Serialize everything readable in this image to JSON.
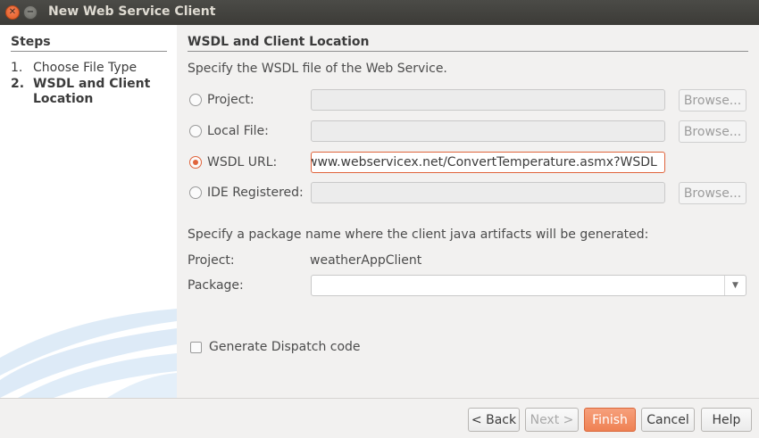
{
  "window": {
    "title": "New Web Service Client"
  },
  "steps": {
    "title": "Steps",
    "items": [
      {
        "num": "1.",
        "label": "Choose File Type"
      },
      {
        "num": "2.",
        "label": "WSDL and Client Location"
      }
    ]
  },
  "section": {
    "title": "WSDL and Client Location",
    "wsdl_prompt": "Specify the WSDL file of the Web Service.",
    "package_prompt": "Specify a package name where the client java artifacts will be generated:"
  },
  "sources": [
    {
      "label": "Project:",
      "value": "",
      "selected": false,
      "browse": "Browse..."
    },
    {
      "label": "Local File:",
      "value": "",
      "selected": false,
      "browse": "Browse..."
    },
    {
      "label": "WSDL URL:",
      "value": "www.webservicex.net/ConvertTemperature.asmx?WSDL",
      "selected": true
    },
    {
      "label": "IDE Registered:",
      "value": "",
      "selected": false,
      "browse": "Browse..."
    }
  ],
  "project": {
    "label": "Project:",
    "value": "weatherAppClient"
  },
  "package": {
    "label": "Package:",
    "value": ""
  },
  "generate_dispatch": {
    "label": "Generate Dispatch code",
    "checked": false
  },
  "buttons": {
    "back": "< Back",
    "next": "Next >",
    "finish": "Finish",
    "cancel": "Cancel",
    "help": "Help"
  },
  "colors": {
    "accent": "#e0643c",
    "titlebar": "#3c3b37",
    "panel_bg": "#f2f1f0"
  }
}
